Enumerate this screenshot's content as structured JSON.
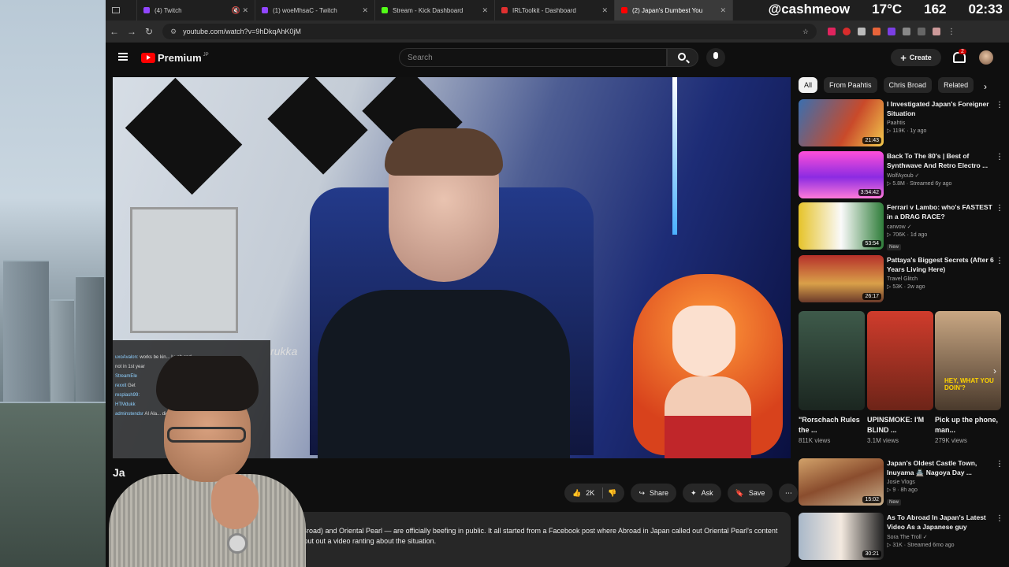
{
  "tabs": [
    {
      "label": "(4) Twitch",
      "color": "#9146ff"
    },
    {
      "label": "(1) woeMhsaC - Twitch",
      "color": "#9146ff"
    },
    {
      "label": "Stream - Kick Dashboard",
      "color": "#53fc18"
    },
    {
      "label": "IRLToolkit - Dashboard",
      "color": "#e03030"
    },
    {
      "label": "(2) Japan's Dumbest You",
      "color": "#ff0000"
    }
  ],
  "stream_overlay": {
    "handle": "@cashmeow",
    "temperature": "17°C",
    "viewers": "162",
    "clock": "02:33"
  },
  "address_bar": {
    "url": "youtube.com/watch?v=9hDkqAhK0jM"
  },
  "header": {
    "logo_text": "Premium",
    "logo_region": "JP",
    "search_placeholder": "Search",
    "create_label": "Create",
    "notification_count": "2"
  },
  "video": {
    "shirt_text": "rukka",
    "title_partial": "Ja"
  },
  "chat_overlay": {
    "lines": [
      {
        "user": "",
        "text": ""
      },
      {
        "user": "uxoAvalon:",
        "text": "works be kin... ly, oh and"
      },
      {
        "user": "",
        "text": "not in 1st year"
      },
      {
        "user": "StreamEle",
        "text": ""
      },
      {
        "user": "rexxit",
        "text": "Get"
      },
      {
        "user": "resplash99:",
        "text": ""
      },
      {
        "user": "HTMdukk",
        "text": ""
      },
      {
        "user": "adminstendsr",
        "text": "AI Ala... dies"
      }
    ]
  },
  "actions": {
    "like_count": "2K",
    "share_label": "Share",
    "ask_label": "Ask",
    "save_label": "Save"
  },
  "description": {
    "line1": "s Broad) and Oriental Pearl — are officially beefing in public. It all started from a Facebook post where Abroad in Japan called out Oriental Pearl's content",
    "line2": "al put out a video ranting about the situation."
  },
  "sidebar": {
    "chips": [
      "All",
      "From Paahtis",
      "Chris Broad",
      "Related"
    ],
    "recommendations": [
      {
        "title": "I Investigated Japan's Foreigner Situation",
        "channel": "Paahtis",
        "meta": "▷ 119K · 1y ago",
        "duration": "21:43",
        "new": "",
        "thumb": "linear-gradient(120deg,#3a6fb0,#c94a2a 60%,#f2c94c)"
      },
      {
        "title": "Back To The 80's | Best of Synthwave And Retro Electro ...",
        "channel": "WolfAyoub ✓",
        "meta": "▷ 5.8M · Streamed 6y ago",
        "duration": "3:54:42",
        "new": "",
        "thumb": "linear-gradient(180deg,#ff4fd8,#8b2be2 55%,#ff7ad9)"
      },
      {
        "title": "Ferrari v Lambo: who's FASTEST in a DRAG RACE?",
        "channel": "carwow ✓",
        "meta": "▷ 706K · 1d ago",
        "duration": "53:54",
        "new": "New",
        "thumb": "linear-gradient(90deg,#e6c32a,#fafafa 50%,#2f7d3a)"
      },
      {
        "title": "Pattaya's Biggest Secrets (After 6 Years Living Here)",
        "channel": "Travel Glitch",
        "meta": "▷ 53K · 2w ago",
        "duration": "26:17",
        "new": "",
        "thumb": "linear-gradient(180deg,#b5302a,#d9a049 60%,#6b3a2a)"
      },
      {
        "title": "Japan's Oldest Castle Town, Inuyama 🏯 Nagoya Day ...",
        "channel": "Josie Vlogs",
        "meta": "▷ 9 · 8h ago",
        "duration": "15:02",
        "new": "New",
        "thumb": "linear-gradient(160deg,#d2a26a,#8a4d2e 50%,#c9b08c)"
      },
      {
        "title": "As To Abroad In Japan's Latest Video As a Japanese guy",
        "channel": "Sora The Troll ✓",
        "meta": "▷ 31K · Streamed 6mo ago",
        "duration": "30:21",
        "new": "",
        "thumb": "linear-gradient(90deg,#a9b8c9,#f3e9df 50%,#222)"
      }
    ],
    "shorts": [
      {
        "title": "\"Rorschach Rules the ...",
        "views": "811K views",
        "thumb": "linear-gradient(180deg,#3e5a4a,#1b2620)"
      },
      {
        "title": "UPINSMOKE: I'M BLIND ...",
        "views": "3.1M views",
        "thumb": "linear-gradient(180deg,#d03c2c,#6d2418)"
      },
      {
        "title": "Pick up the phone, man...",
        "views": "279K views",
        "thumb": "linear-gradient(180deg,#c9a783,#4a3a2c)"
      }
    ],
    "shorts_caption": "HEY, WHAT YOU DOIN'?"
  }
}
